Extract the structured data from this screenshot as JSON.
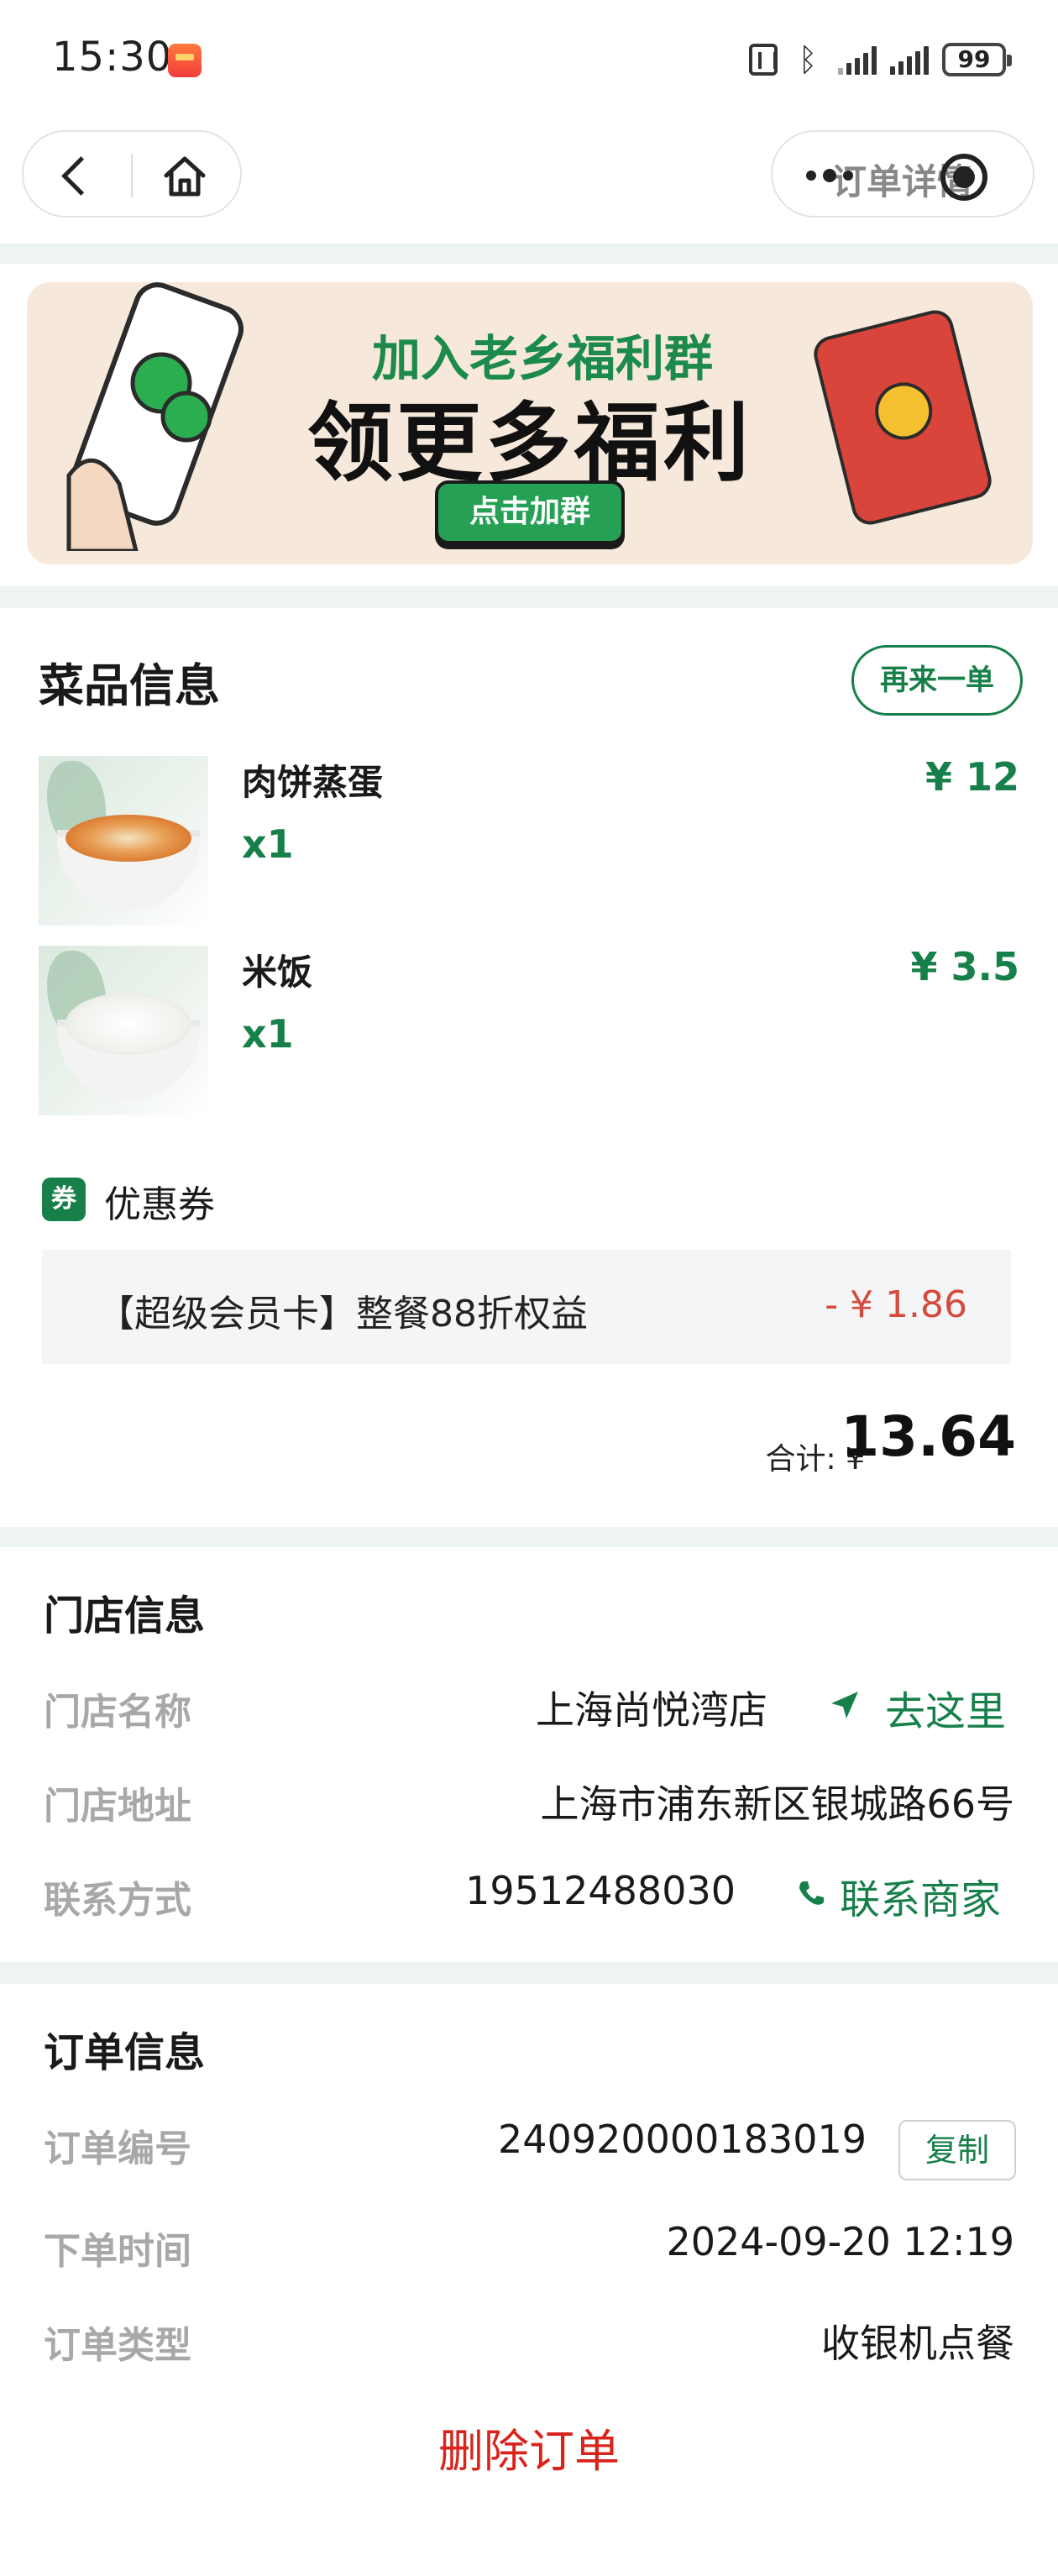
{
  "status_bar": {
    "time": "15:30",
    "battery": "99"
  },
  "nav": {
    "title": "订单详情"
  },
  "banner": {
    "line1": "加入老乡福利群",
    "line2": "领更多福利",
    "button": "点击加群"
  },
  "dishes_section": {
    "title": "菜品信息",
    "reorder_label": "再来一单",
    "items": [
      {
        "name": "肉饼蒸蛋",
        "qty": "x1",
        "price": "¥ 12"
      },
      {
        "name": "米饭",
        "qty": "x1",
        "price": "¥ 3.5"
      }
    ]
  },
  "coupon": {
    "icon_text": "券",
    "label": "优惠券",
    "name": "【超级会员卡】整餐88折权益",
    "amount": "- ¥ 1.86"
  },
  "total": {
    "label": "合计: ¥",
    "value": "13.64"
  },
  "store_section": {
    "title": "门店信息",
    "name_label": "门店名称",
    "name_value": "上海尚悦湾店",
    "navigate_label": "去这里",
    "address_label": "门店地址",
    "address_value": "上海市浦东新区银城路66号",
    "contact_label": "联系方式",
    "contact_value": "19512488030",
    "contact_action": "联系商家"
  },
  "order_section": {
    "title": "订单信息",
    "number_label": "订单编号",
    "number_value": "240920000183019",
    "copy_label": "复制",
    "time_label": "下单时间",
    "time_value": "2024-09-20 12:19",
    "type_label": "订单类型",
    "type_value": "收银机点餐",
    "delete_label": "删除订单"
  },
  "colors": {
    "accent": "#17804a",
    "discount": "#d54a3c",
    "delete": "#d9241c"
  }
}
